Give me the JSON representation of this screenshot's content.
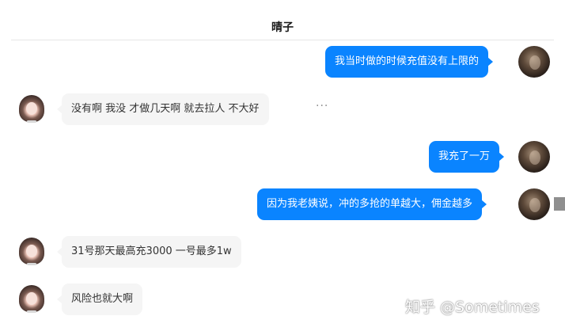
{
  "header": {
    "title": "晴子"
  },
  "messages": [
    {
      "side": "out",
      "text": "我当时做的时候充值没有上限的"
    },
    {
      "side": "in",
      "text": "没有啊  我没   才做几天啊  就去拉人 不大好"
    },
    {
      "side": "out",
      "text": "我充了一万"
    },
    {
      "side": "out",
      "text": "因为我老姨说，冲的多抢的单越大，佣金越多"
    },
    {
      "side": "in",
      "text": "31号那天最高充3000   一号最多1w"
    },
    {
      "side": "in",
      "text": "风险也就大啊"
    }
  ],
  "more_menu": "···",
  "watermark": "知乎 @Sometimes",
  "icons": {
    "more": "more-horizontal-icon",
    "avatar_contact": "avatar-girl",
    "avatar_self": "avatar-dark"
  },
  "colors": {
    "outgoing_bubble": "#0a84ff",
    "incoming_bubble": "#f5f5f5"
  }
}
